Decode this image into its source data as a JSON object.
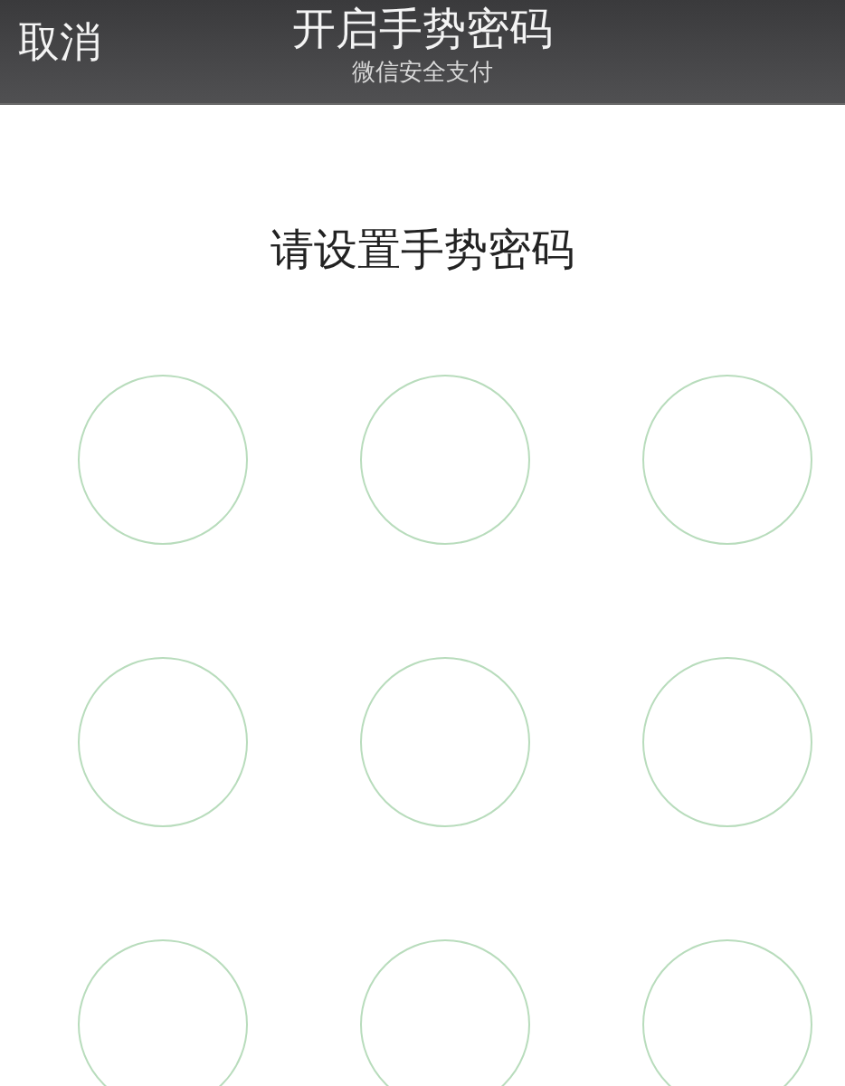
{
  "nav_bar": {
    "cancel": "取消",
    "title": "开启手势密码",
    "subtitle": "微信安全支付"
  },
  "prompt": "请设置手势密码",
  "gesture_dots": [
    {
      "selected": false
    },
    {
      "selected": false
    },
    {
      "selected": false
    },
    {
      "selected": false
    },
    {
      "selected": false
    },
    {
      "selected": false
    },
    {
      "selected": false
    },
    {
      "selected": false
    },
    {
      "selected": false
    }
  ]
}
